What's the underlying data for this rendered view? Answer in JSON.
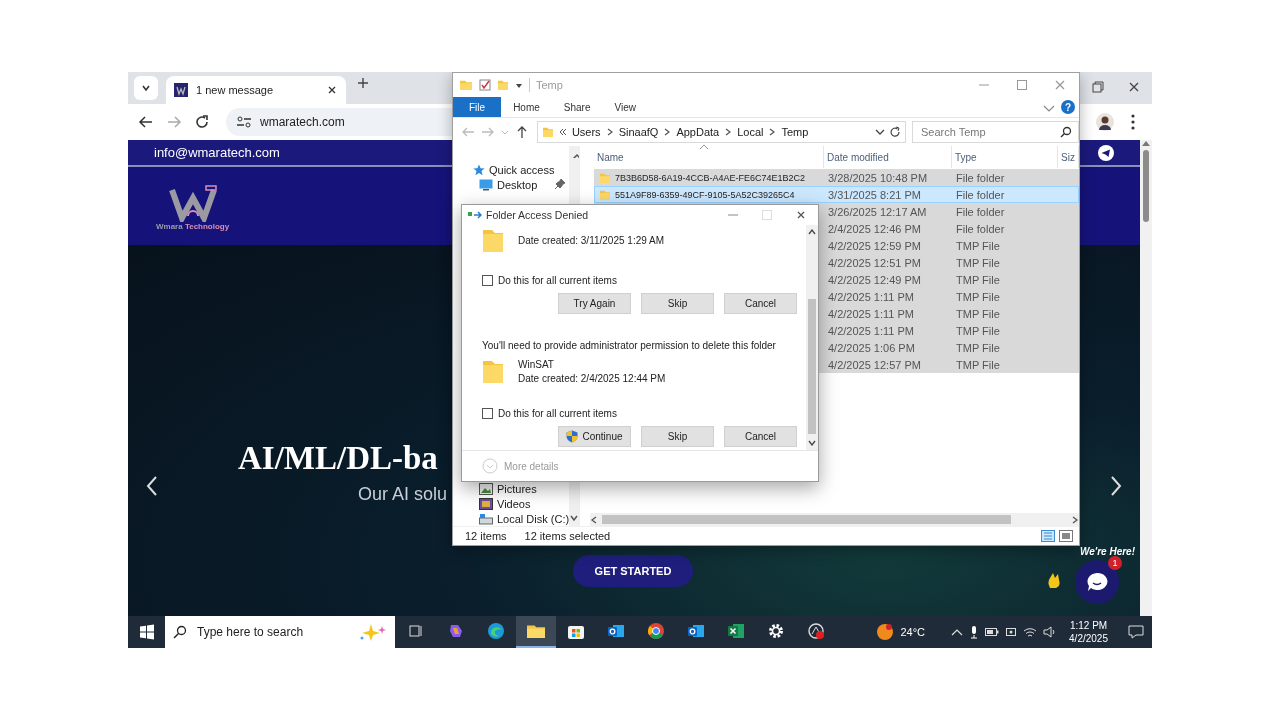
{
  "browser": {
    "tab": {
      "title": "1 new message"
    },
    "url": "wmaratech.com",
    "page": {
      "email": "info@wmaratech.com",
      "logo_text": "Wmara **Technology**",
      "headline": "AI/ML/DL-ba",
      "subtitle": "Our AI solu",
      "cta": "GET STARTED",
      "chat": {
        "label": "We're Here!",
        "badge": "1"
      }
    }
  },
  "explorer": {
    "title": "Temp",
    "ribbon_tabs": [
      {
        "label": "File",
        "selected": true
      },
      {
        "label": "Home",
        "selected": false
      },
      {
        "label": "Share",
        "selected": false
      },
      {
        "label": "View",
        "selected": false
      }
    ],
    "help": "?",
    "breadcrumb": [
      "Users",
      "SinaafQ",
      "AppData",
      "Local",
      "Temp"
    ],
    "search": {
      "placeholder": "Search Temp"
    },
    "nav_items": [
      {
        "label": "Quick access",
        "kind": "star",
        "pinned": false
      },
      {
        "label": "Desktop",
        "kind": "desktop",
        "pinned": true
      },
      {
        "label": "Pictures",
        "kind": "pictures",
        "pinned": false
      },
      {
        "label": "Videos",
        "kind": "videos",
        "pinned": false
      },
      {
        "label": "Local Disk (C:)",
        "kind": "disk",
        "pinned": false
      }
    ],
    "columns": [
      "Name",
      "Date modified",
      "Type",
      "Siz"
    ],
    "files": [
      {
        "name": "7B3B6D58-6A19-4CCB-A4AE-FE6C74E1B2C2",
        "date": "3/28/2025 10:48 PM",
        "type": "File folder",
        "selected": true,
        "hot": false
      },
      {
        "name": "551A9F89-6359-49CF-9105-5A52C39265C4",
        "date": "3/31/2025 8:21 PM",
        "type": "File folder",
        "selected": true,
        "hot": true
      },
      {
        "date": "3/26/2025 12:17 AM",
        "type": "File folder",
        "selected": true,
        "hot": false
      },
      {
        "date": "2/4/2025 12:46 PM",
        "type": "File folder",
        "selected": true,
        "hot": false
      },
      {
        "date": "4/2/2025 12:59 PM",
        "type": "TMP File",
        "selected": true,
        "hot": false
      },
      {
        "date": "4/2/2025 12:51 PM",
        "type": "TMP File",
        "selected": true,
        "hot": false
      },
      {
        "date": "4/2/2025 12:49 PM",
        "type": "TMP File",
        "selected": true,
        "hot": false
      },
      {
        "date": "4/2/2025 1:11 PM",
        "type": "TMP File",
        "selected": true,
        "hot": false
      },
      {
        "date": "4/2/2025 1:11 PM",
        "type": "TMP File",
        "selected": true,
        "hot": false
      },
      {
        "date": "4/2/2025 1:11 PM",
        "type": "TMP File",
        "selected": true,
        "hot": false
      },
      {
        "date": "4/2/2025 1:06 PM",
        "type": "TMP File",
        "selected": true,
        "hot": false
      },
      {
        "date": "4/2/2025 12:57 PM",
        "type": "TMP File",
        "selected": true,
        "hot": false
      }
    ],
    "status": {
      "count": "12 items",
      "selection": "12 items selected"
    }
  },
  "dialog": {
    "title": "Folder Access Denied",
    "blocks": [
      {
        "date": "Date created: 3/11/2025 1:29 AM",
        "checkbox": {
          "label": "Do this for all current items",
          "checked": false
        },
        "buttons": [
          {
            "label": "Try Again",
            "shield": false
          },
          {
            "label": "Skip",
            "shield": false
          },
          {
            "label": "Cancel",
            "shield": false
          }
        ]
      },
      {
        "message": "You'll need to provide administrator permission to delete this folder",
        "name": "WinSAT",
        "date": "Date created: 2/4/2025 12:44 PM",
        "checkbox": {
          "label": "Do this for all current items",
          "checked": false
        },
        "buttons": [
          {
            "label": "Continue",
            "shield": true
          },
          {
            "label": "Skip",
            "shield": false
          },
          {
            "label": "Cancel",
            "shield": false
          }
        ]
      }
    ],
    "more_details": "More details"
  },
  "taskbar": {
    "search": {
      "placeholder": "Type here to search"
    },
    "apps": [
      {
        "kind": "taskview",
        "active": false
      },
      {
        "kind": "copilot",
        "active": false
      },
      {
        "kind": "edge",
        "active": false
      },
      {
        "kind": "explorer",
        "active": true
      },
      {
        "kind": "store",
        "active": false
      },
      {
        "kind": "outlook",
        "active": false
      },
      {
        "kind": "chrome",
        "active": false
      },
      {
        "kind": "outlook",
        "active": false
      },
      {
        "kind": "excel",
        "active": false
      },
      {
        "kind": "settings",
        "active": false
      },
      {
        "kind": "camera",
        "active": false
      }
    ],
    "weather": "24°C",
    "time": "1:12 PM",
    "date": "4/2/2025"
  }
}
